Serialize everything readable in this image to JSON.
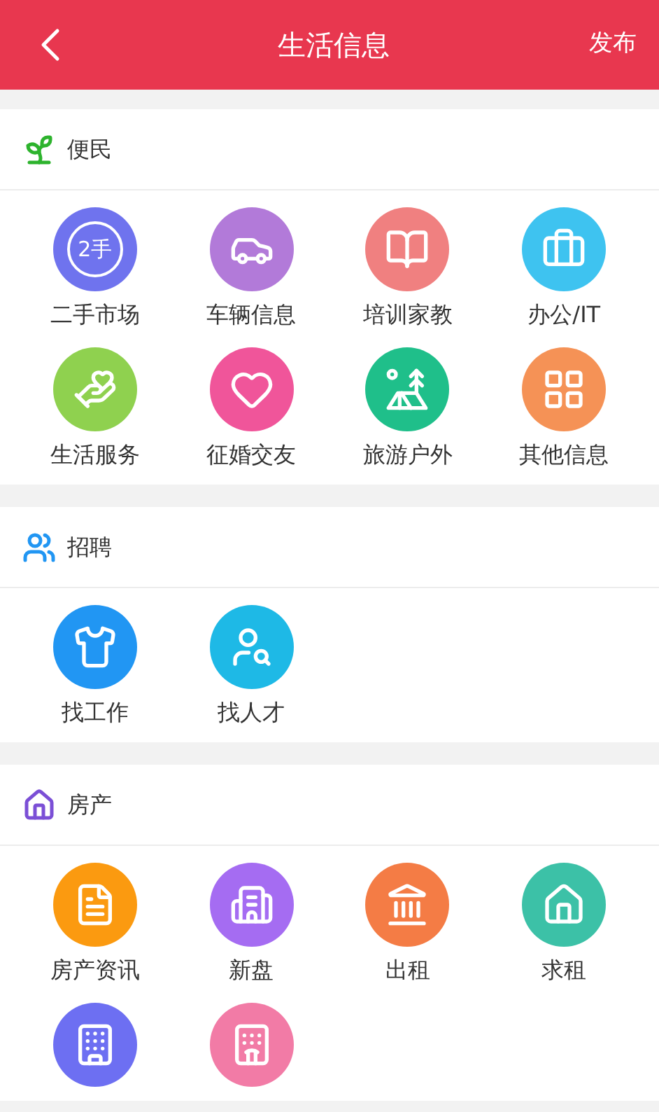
{
  "header": {
    "title": "生活信息",
    "action": "发布"
  },
  "sections": [
    {
      "title": "便民",
      "items": [
        {
          "label": "二手市场",
          "color": "#6f73ee",
          "badge_text": "2手"
        },
        {
          "label": "车辆信息",
          "color": "#b27ad9"
        },
        {
          "label": "培训家教",
          "color": "#f08080"
        },
        {
          "label": "办公/IT",
          "color": "#3ec3f0"
        },
        {
          "label": "生活服务",
          "color": "#8fd14f"
        },
        {
          "label": "征婚交友",
          "color": "#f0559a"
        },
        {
          "label": "旅游户外",
          "color": "#1fbf8a"
        },
        {
          "label": "其他信息",
          "color": "#f59256"
        }
      ]
    },
    {
      "title": "招聘",
      "items": [
        {
          "label": "找工作",
          "color": "#2196f3"
        },
        {
          "label": "找人才",
          "color": "#1eb9e6"
        }
      ]
    },
    {
      "title": "房产",
      "items": [
        {
          "label": "房产资讯",
          "color": "#fb9a10"
        },
        {
          "label": "新盘",
          "color": "#a56cf2"
        },
        {
          "label": "出租",
          "color": "#f47c45"
        },
        {
          "label": "求租",
          "color": "#3cc1a7"
        },
        {
          "color": "#6d6ff2"
        },
        {
          "color": "#f27ba6"
        }
      ]
    }
  ]
}
